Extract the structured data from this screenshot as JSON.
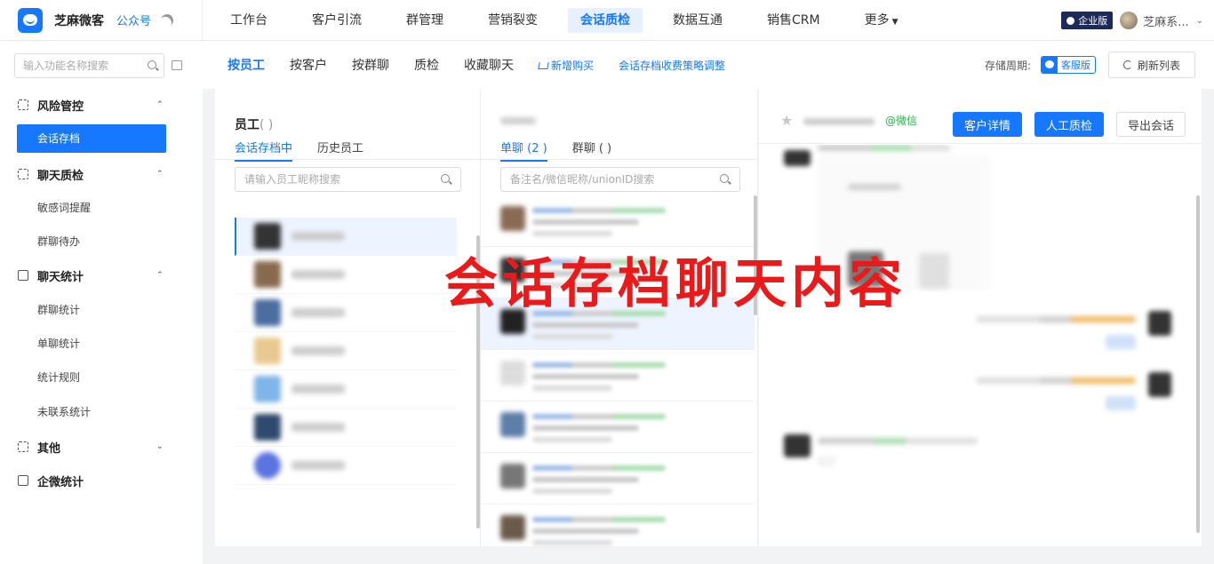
{
  "topbar": {
    "brand_name": "芝麻微客",
    "brand_sub": "公众号",
    "nav": [
      "工作台",
      "客户引流",
      "群管理",
      "营销裂变",
      "会话质检",
      "数据互通",
      "销售CRM",
      "更多"
    ],
    "active_nav": "会话质检",
    "edition": "企业版",
    "user_name": "芝麻系..."
  },
  "sidebar": {
    "search_placeholder": "输入功能名称搜索",
    "groups": [
      {
        "label": "风险管控",
        "items": [
          "会话存档"
        ]
      },
      {
        "label": "聊天质检",
        "items": [
          "敏感词提醒",
          "群聊待办"
        ]
      },
      {
        "label": "聊天统计",
        "items": [
          "群聊统计",
          "单聊统计",
          "统计规则",
          "未联系统计"
        ]
      },
      {
        "label": "其他",
        "items": []
      },
      {
        "label": "企微统计",
        "items": []
      }
    ],
    "active_item": "会话存档"
  },
  "subbar": {
    "tabs": [
      "按员工",
      "按客户",
      "按群聊",
      "质检",
      "收藏聊天"
    ],
    "active_tab": "按员工",
    "buy_link": "新增购买",
    "policy_link": "会话存档收费策略调整",
    "storage_label": "存储周期:",
    "service_badge": "客服版",
    "refresh_label": "刷新列表"
  },
  "employee_panel": {
    "title": "员工",
    "title_count": "(  )",
    "tabs": [
      "会话存档中",
      "历史员工"
    ],
    "search_placeholder": "请输入员工昵称搜索"
  },
  "chat_panel": {
    "tabs": [
      "单聊 (2   )",
      "群聊 (     )"
    ],
    "search_placeholder": "备注名/微信昵称/unionID搜索"
  },
  "conversation_panel": {
    "wechat_tag": "@微信",
    "customer_detail_label": "客户详情",
    "manual_check_label": "人工质检",
    "export_label": "导出会话"
  },
  "overlay_text": "会话存档聊天内容",
  "colors": {
    "primary": "#1677ff",
    "overlay_red": "#ea1a1a",
    "wechat_green": "#2bb24c"
  }
}
